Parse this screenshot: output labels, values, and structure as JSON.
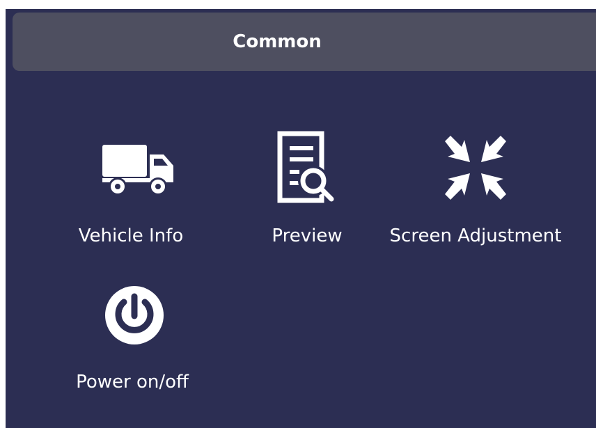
{
  "header": {
    "title": "Common"
  },
  "items": [
    {
      "label": "Vehicle Info",
      "icon": "truck-icon"
    },
    {
      "label": "Preview",
      "icon": "document-search-icon"
    },
    {
      "label": "Screen Adjustment",
      "icon": "shrink-arrows-icon"
    },
    {
      "label": "Power on/off",
      "icon": "power-icon"
    }
  ],
  "colors": {
    "background": "#2c2e53",
    "tab_bar": "#4e4f60",
    "text": "#ffffff"
  }
}
